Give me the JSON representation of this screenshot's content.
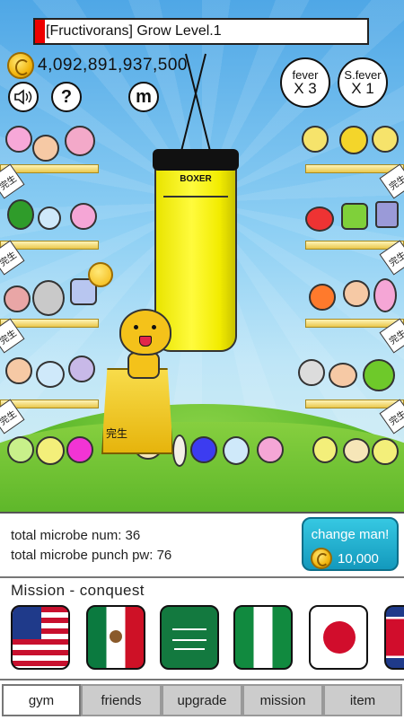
{
  "hud": {
    "grow_status": "[Fructivorans] Grow Level.1",
    "grow_progress": 0.03,
    "coin_total": "4,092,891,937,500",
    "sound_icon": "speaker-icon",
    "help_label": "?",
    "menu_label": "m",
    "fever": {
      "label": "fever",
      "multiplier": "X 3"
    },
    "super_fever": {
      "label": "S.fever",
      "multiplier": "X 1"
    }
  },
  "scene": {
    "bag_brand": "BOXER",
    "pedestal_label": "完生",
    "shelf_tag": "完生",
    "shelf_tag_right": "完生"
  },
  "stats": {
    "microbe_num_line": "total microbe num: 36",
    "punch_pw_line": "total microbe punch pw: 76"
  },
  "change_man": {
    "label": "change man!",
    "cost": "10,000"
  },
  "mission": {
    "title": "Mission - conquest",
    "flags": [
      "usa-flag-icon",
      "mexico-flag-icon",
      "saudi-arabia-flag-icon",
      "nigeria-flag-icon",
      "japan-flag-icon",
      "north-korea-flag-icon"
    ]
  },
  "tabs": [
    {
      "label": "gym",
      "active": true
    },
    {
      "label": "friends",
      "active": false
    },
    {
      "label": "upgrade",
      "active": false
    },
    {
      "label": "mission",
      "active": false
    },
    {
      "label": "item",
      "active": false
    }
  ],
  "colors": {
    "sky": "#5fb0ea",
    "grass": "#5cb82b",
    "bag": "#fffb3d",
    "button_accent": "#1fa9cc",
    "grow_bar_fill": "#ee0000"
  }
}
